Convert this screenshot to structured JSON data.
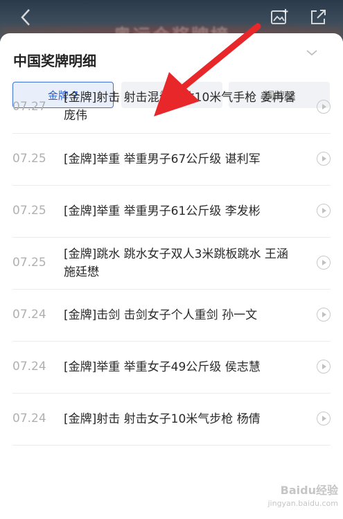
{
  "header": {
    "title": "奥运会奖牌榜"
  },
  "sheet": {
    "title": "中国奖牌明细",
    "tabs": [
      {
        "label": "金牌·7",
        "active": true
      },
      {
        "label": "银牌·",
        "active": false
      },
      {
        "label": "铜牌·7",
        "active": false
      }
    ]
  },
  "medals": [
    {
      "date": "07.27",
      "text": "[金牌]射击 射击混合团体10米气手枪 姜冉馨　庞伟"
    },
    {
      "date": "07.25",
      "text": "[金牌]举重 举重男子67公斤级 谌利军"
    },
    {
      "date": "07.25",
      "text": "[金牌]举重 举重男子61公斤级 李发彬"
    },
    {
      "date": "07.25",
      "text": "[金牌]跳水 跳水女子双人3米跳板跳水 王涵 施廷懋"
    },
    {
      "date": "07.24",
      "text": "[金牌]击剑 击剑女子个人重剑 孙一文"
    },
    {
      "date": "07.24",
      "text": "[金牌]举重 举重女子49公斤级 侯志慧"
    },
    {
      "date": "07.24",
      "text": "[金牌]射击 射击女子10米气步枪 杨倩"
    }
  ],
  "watermark": {
    "brand": "Baidu经验",
    "sub": "jingyan.baidu.com"
  },
  "colors": {
    "accent": "#3c6fd1",
    "annotation_arrow": "#e8272b"
  }
}
